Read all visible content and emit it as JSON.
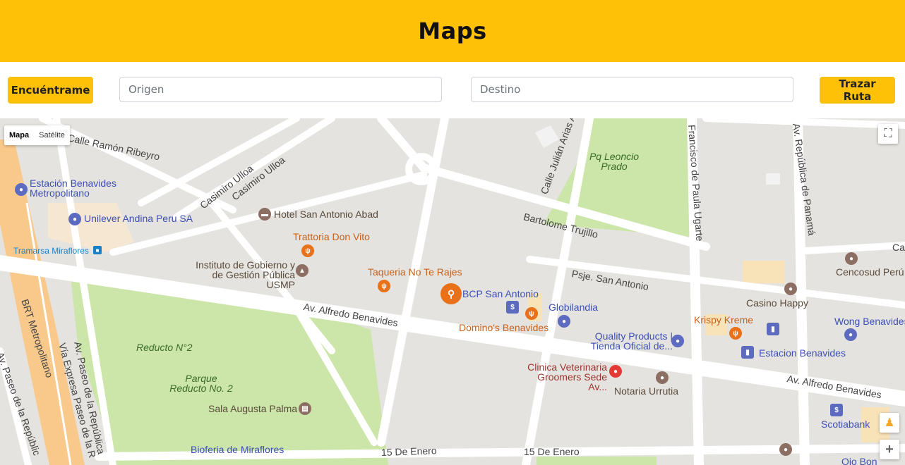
{
  "header": {
    "title": "Maps"
  },
  "controls": {
    "locate_label": "Encuéntrame",
    "origin_placeholder": "Origen",
    "destination_placeholder": "Destino",
    "route_label": "Trazar Ruta"
  },
  "map": {
    "type_control": {
      "map": "Mapa",
      "satellite": "Satélite"
    },
    "roads": {
      "ramon_ribeyro": "Calle Ramón Ribeyro",
      "casimiro_1": "Casimiro Ulloa",
      "casimiro_2": "Casimiro Ulloa",
      "julian_arias": "Calle Julián Arias A",
      "bartolome": "Bartolome Trujillo",
      "francisco": "Francisco de Paula Ugarte",
      "republica_panama": "Av. República de Panamá",
      "san_antonio": "Psje. San Antonio",
      "benavides_1": "Av. Alfredo Benavides",
      "benavides_2": "Av. Alfredo Benavides",
      "brt": "BRT Metropolitano",
      "via_expresa": "Vía Expresa Paseo de la R",
      "paseo_rep_1": "Av. Paseo de la República",
      "paseo_rep_2": "Av. Paseo de la Repúblic",
      "enero_1": "15 De Enero",
      "enero_2": "15 De Enero",
      "ca": "Ca"
    },
    "parks": {
      "leoncio": "Pq Leoncio Prado",
      "reducto_n2": "Reducto N°2",
      "parque_reducto": "Parque Reducto No. 2"
    },
    "pois": {
      "estacion_benavides_metro": "Estación Benavides Metropolitano",
      "unilever": "Unilever Andina Peru SA",
      "tramarsa": "Tramarsa Miraflores",
      "hotel": "Hotel San Antonio Abad",
      "trattoria": "Trattoria Don Vito",
      "instituto": "Instituto de Gobierno y de Gestión Pública USMP",
      "taqueria": "Taqueria No Te Rajes",
      "bcp": "BCP San Antonio",
      "globilandia": "Globilandia",
      "dominos": "Domino's Benavides",
      "quality": "Quality Products | Tienda Oficial de...",
      "clinica": "Clinica Veterinaria Groomers Sede Av...",
      "notaria": "Notaria Urrutia",
      "sala_augusta": "Sala Augusta Palma",
      "bioferia": "Bioferia de Miraflores",
      "krispy": "Krispy Kreme",
      "casino": "Casino Happy",
      "cencosud": "Cencosud Perú",
      "wong": "Wong Benavides",
      "estacion_benavides": "Estacion Benavides",
      "scotiabank": "Scotiabank",
      "ojo": "Ojo Bon"
    },
    "zoom_in": "+"
  },
  "colors": {
    "accent": "#ffc107",
    "park": "#cce6a9",
    "road": "#ffffff",
    "highway": "#f9c98b",
    "land": "#e5e3df"
  }
}
